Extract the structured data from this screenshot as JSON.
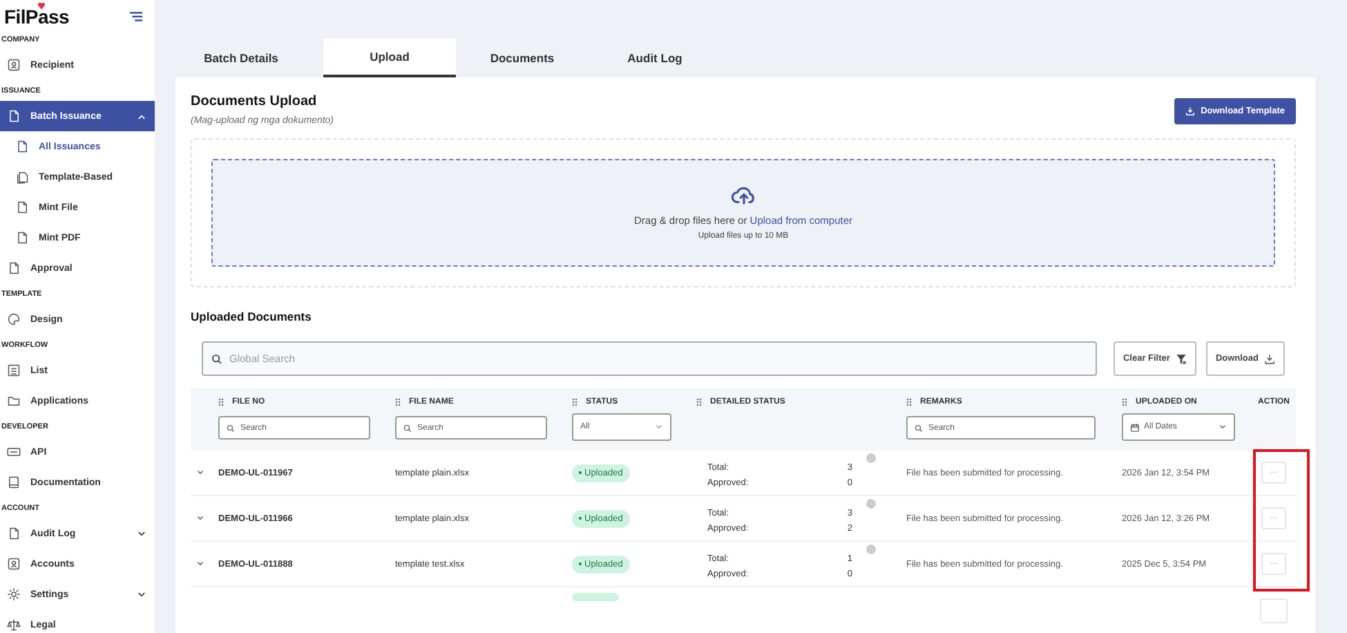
{
  "sidebar": {
    "logo": "FilPass",
    "sections": [
      {
        "heading": "COMPANY",
        "items": [
          {
            "label": "Recipient",
            "selected": false
          }
        ]
      },
      {
        "heading": "ISSUANCE",
        "items": [
          {
            "label": "Batch Issuance",
            "selected": true,
            "expanded": true,
            "children": [
              {
                "label": "All Issuances",
                "selected": true
              },
              {
                "label": "Template-Based",
                "selected": false
              },
              {
                "label": "Mint File",
                "selected": false
              },
              {
                "label": "Mint PDF",
                "selected": false
              }
            ]
          },
          {
            "label": "Approval",
            "selected": false
          }
        ]
      },
      {
        "heading": "TEMPLATE",
        "items": [
          {
            "label": "Design",
            "selected": false
          }
        ]
      },
      {
        "heading": "WORKFLOW",
        "items": [
          {
            "label": "List",
            "selected": false
          },
          {
            "label": "Applications",
            "selected": false
          }
        ]
      },
      {
        "heading": "DEVELOPER",
        "items": [
          {
            "label": "API",
            "selected": false
          },
          {
            "label": "Documentation",
            "selected": false
          }
        ]
      },
      {
        "heading": "ACCOUNT",
        "items": [
          {
            "label": "Audit Log",
            "selected": false,
            "expanded": false
          },
          {
            "label": "Accounts",
            "selected": false
          },
          {
            "label": "Settings",
            "selected": false,
            "expanded": false
          },
          {
            "label": "Legal",
            "selected": false
          }
        ]
      }
    ]
  },
  "tabs": [
    {
      "label": "Batch Details",
      "selected": false
    },
    {
      "label": "Upload",
      "selected": true
    },
    {
      "label": "Documents",
      "selected": false
    },
    {
      "label": "Audit Log",
      "selected": false
    }
  ],
  "upload": {
    "title": "Documents Upload",
    "subtitle": "(Mag-upload ng mga dokumento)",
    "button": "Download Template",
    "drop_text": "Drag & drop files here or",
    "drop_link": "Upload from computer",
    "limit": "Upload files up to 10 MB"
  },
  "documents": {
    "title": "Uploaded Documents",
    "search": {
      "placeholder": "Global Search"
    },
    "buttons": [
      "Clear Filter",
      "Download"
    ],
    "columns": [
      {
        "label": "FILE NO",
        "kind": "search",
        "placeholder": "Search"
      },
      {
        "label": "FILE NAME",
        "kind": "search",
        "placeholder": "Search"
      },
      {
        "label": "STATUS",
        "kind": "select",
        "value": "All"
      },
      {
        "label": "DETAILED STATUS"
      },
      {
        "label": "REMARKS",
        "kind": "search",
        "placeholder": "Search"
      },
      {
        "label": "UPLOADED ON",
        "kind": "date",
        "value": "All Dates"
      },
      {
        "label": "ACTION"
      }
    ],
    "rows": [
      {
        "expanded": false,
        "file_no": "DEMO-UL-011967",
        "file_name": "template plain.xlsx",
        "status": "Uploaded",
        "total_label": "Total:",
        "total": "3",
        "approved_label": "Approved:",
        "approved": "0",
        "remarks": "File has been submitted for processing.",
        "uploaded_on": "2026 Jan 12, 3:54 PM",
        "action": "···"
      },
      {
        "expanded": false,
        "file_no": "DEMO-UL-011966",
        "file_name": "template plain.xlsx",
        "status": "Uploaded",
        "total_label": "Total:",
        "total": "3",
        "approved_label": "Approved:",
        "approved": "2",
        "remarks": "File has been submitted for processing.",
        "uploaded_on": "2026 Jan 12, 3:26 PM",
        "action": "···"
      },
      {
        "expanded": false,
        "file_no": "DEMO-UL-011888",
        "file_name": "template test.xlsx",
        "status": "Uploaded",
        "total_label": "Total:",
        "total": "1",
        "approved_label": "Approved:",
        "approved": "0",
        "remarks": "File has been submitted for processing.",
        "uploaded_on": "2025 Dec 5, 3:54 PM",
        "action": "···"
      }
    ],
    "annotation": {
      "kind": "highlight-box"
    }
  }
}
